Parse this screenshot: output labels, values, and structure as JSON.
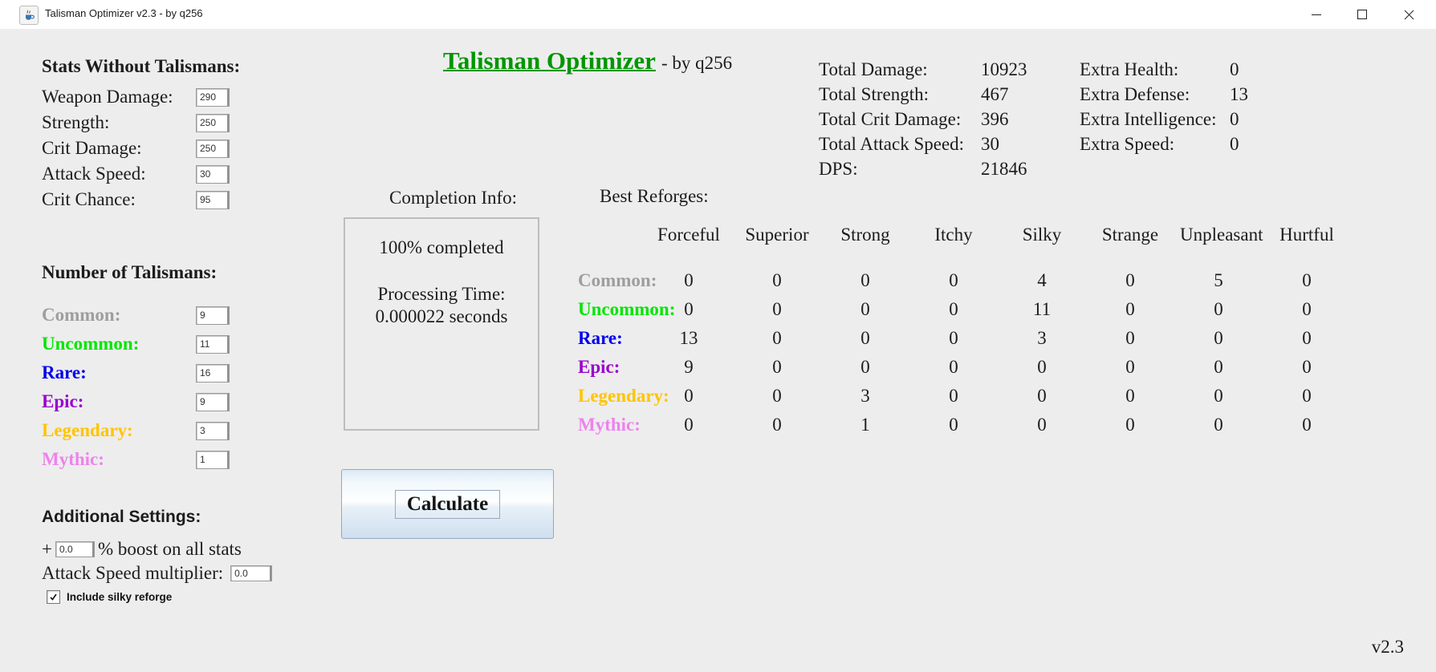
{
  "titlebar": {
    "title": "Talisman Optimizer v2.3 - by q256"
  },
  "header": {
    "title": "Talisman Optimizer",
    "byline": " - by q256",
    "title_color": "#009600"
  },
  "stats_without_talismans": {
    "heading": "Stats Without Talismans:",
    "fields": [
      {
        "label": "Weapon Damage:",
        "value": "290"
      },
      {
        "label": "Strength:",
        "value": "250"
      },
      {
        "label": "Crit Damage:",
        "value": "250"
      },
      {
        "label": "Attack Speed:",
        "value": "30"
      },
      {
        "label": "Crit Chance:",
        "value": "95"
      }
    ]
  },
  "number_of_talismans": {
    "heading": "Number of Talismans:",
    "fields": [
      {
        "label": "Common:",
        "value": "9",
        "color": "#9e9e9e"
      },
      {
        "label": "Uncommon:",
        "value": "11",
        "color": "#00e600"
      },
      {
        "label": "Rare:",
        "value": "16",
        "color": "#0000ee"
      },
      {
        "label": "Epic:",
        "value": "9",
        "color": "#9900cc"
      },
      {
        "label": "Legendary:",
        "value": "3",
        "color": "#ffc400"
      },
      {
        "label": "Mythic:",
        "value": "1",
        "color": "#ee82ee"
      }
    ]
  },
  "additional_settings": {
    "heading": "Additional Settings:",
    "boost": {
      "prefix": "+",
      "value": "0.0",
      "suffix": "% boost on all stats"
    },
    "attack_speed_multiplier": {
      "label": "Attack Speed multiplier:",
      "value": "0.0"
    },
    "silky_checkbox": {
      "label": "Include silky reforge",
      "checked": true
    }
  },
  "completion": {
    "heading": "Completion Info:",
    "status": "100% completed",
    "processing_label": "Processing Time:",
    "processing_value": "0.000022 seconds"
  },
  "calculate_button_label": "Calculate",
  "totals": {
    "rows": [
      {
        "label": "Total Damage:",
        "value": "10923"
      },
      {
        "label": "Total Strength:",
        "value": "467"
      },
      {
        "label": "Total Crit Damage:",
        "value": "396"
      },
      {
        "label": "Total Attack Speed:",
        "value": "30"
      },
      {
        "label": "DPS:",
        "value": "21846"
      }
    ]
  },
  "extras": {
    "rows": [
      {
        "label": "Extra Health:",
        "value": "0"
      },
      {
        "label": "Extra Defense:",
        "value": "13"
      },
      {
        "label": "Extra Intelligence:",
        "value": "0"
      },
      {
        "label": "Extra Speed:",
        "value": "0"
      }
    ]
  },
  "best_reforges": {
    "heading": "Best Reforges:",
    "columns": [
      "Forceful",
      "Superior",
      "Strong",
      "Itchy",
      "Silky",
      "Strange",
      "Unpleasant",
      "Hurtful"
    ],
    "rows": [
      {
        "label": "Common:",
        "color": "#9e9e9e",
        "values": [
          0,
          0,
          0,
          0,
          4,
          0,
          5,
          0
        ]
      },
      {
        "label": "Uncommon:",
        "color": "#00e600",
        "values": [
          0,
          0,
          0,
          0,
          11,
          0,
          0,
          0
        ]
      },
      {
        "label": "Rare:",
        "color": "#0000ee",
        "values": [
          13,
          0,
          0,
          0,
          3,
          0,
          0,
          0
        ]
      },
      {
        "label": "Epic:",
        "color": "#9900cc",
        "values": [
          9,
          0,
          0,
          0,
          0,
          0,
          0,
          0
        ]
      },
      {
        "label": "Legendary:",
        "color": "#ffc400",
        "values": [
          0,
          0,
          3,
          0,
          0,
          0,
          0,
          0
        ]
      },
      {
        "label": "Mythic:",
        "color": "#ee82ee",
        "values": [
          0,
          0,
          1,
          0,
          0,
          0,
          0,
          0
        ]
      }
    ]
  },
  "version_label": "v2.3"
}
